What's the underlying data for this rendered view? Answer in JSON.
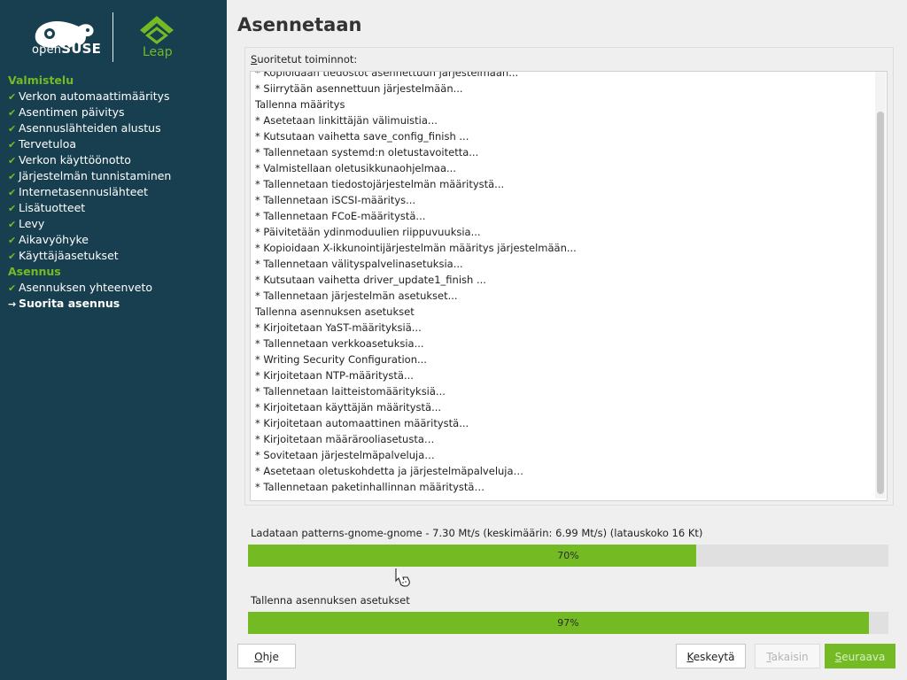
{
  "sidebar": {
    "logo_open": "open",
    "logo_suse": "SUSE",
    "logo_leap": "Leap",
    "sections": [
      {
        "title": "Valmistelu",
        "items": [
          "Verkon automaattimääritys",
          "Asentimen päivitys",
          "Asennuslähteiden alustus",
          "Tervetuloa",
          "Verkon käyttöönotto",
          "Järjestelmän tunnistaminen",
          "Internetasennuslähteet",
          "Lisätuotteet",
          "Levy",
          "Aikavyöhyke",
          "Käyttäjäasetukset"
        ]
      },
      {
        "title": "Asennus",
        "items": [
          "Asennuksen yhteenveto",
          "Suorita asennus"
        ]
      }
    ],
    "current_step": "Suorita asennus",
    "done_icon": "check-icon",
    "current_icon": "arrow-right-icon"
  },
  "main": {
    "title": "Asennetaan",
    "log_label": "Suoritetut toiminnot:",
    "log_lines": [
      "* Kopioidaan tiedostot asennettuun järjestelmään...",
      "* Siirrytään asennettuun järjestelmään...",
      "Tallenna määritys",
      "* Asetetaan linkittäjän välimuistia...",
      "* Kutsutaan vaihetta save_config_finish ...",
      "* Tallennetaan systemd:n oletustavoitetta...",
      "* Valmistellaan oletusikkunaohjelmaa...",
      "* Tallennetaan tiedostojärjestelmän määritystä...",
      "* Tallennetaan iSCSI-määritys...",
      "* Tallennetaan FCoE-määritystä...",
      "* Päivitetään ydinmoduulien riippuvuuksia...",
      "* Kopioidaan X-ikkunointijärjestelmän määritys järjestelmään...",
      "* Tallennetaan välityspalvelinasetuksia...",
      "* Kutsutaan vaihetta driver_update1_finish ...",
      "* Tallennetaan järjestelmän asetukset...",
      "Tallenna asennuksen asetukset",
      "* Kirjoitetaan YaST-määrityksiä...",
      "* Tallennetaan verkkoasetuksia...",
      "* Writing Security Configuration...",
      "* Kirjoitetaan NTP-määritystä...",
      "* Tallennetaan laitteistomäärityksiä...",
      "* Kirjoitetaan käyttäjän määritystä...",
      "* Kirjoitetaan automaattinen määritystä...",
      "* Kirjoitetaan määrärooliasetusta…",
      "* Sovitetaan järjestelmäpalveluja…",
      "* Asetetaan oletuskohdetta ja järjestelmäpalveluja…",
      "* Tallennetaan paketinhallinnan määritystä…"
    ],
    "download_label": "Ladataan patterns-gnome-gnome - 7.30 Mt/s (keskimäärin: 6.99 Mt/s) (latauskoko 16 Kt)",
    "download_progress": 70,
    "download_percent_text": "70%",
    "stage_label": "Tallenna asennuksen asetukset",
    "stage_progress": 97,
    "stage_percent_text": "97%"
  },
  "buttons": {
    "help": "Ohje",
    "abort": "Keskeytä",
    "back": "Takaisin",
    "next": "Seuraava"
  },
  "colors": {
    "sidebar_bg": "#173f4f",
    "accent_green": "#73ba25",
    "progress_fill": "#74ba23"
  }
}
